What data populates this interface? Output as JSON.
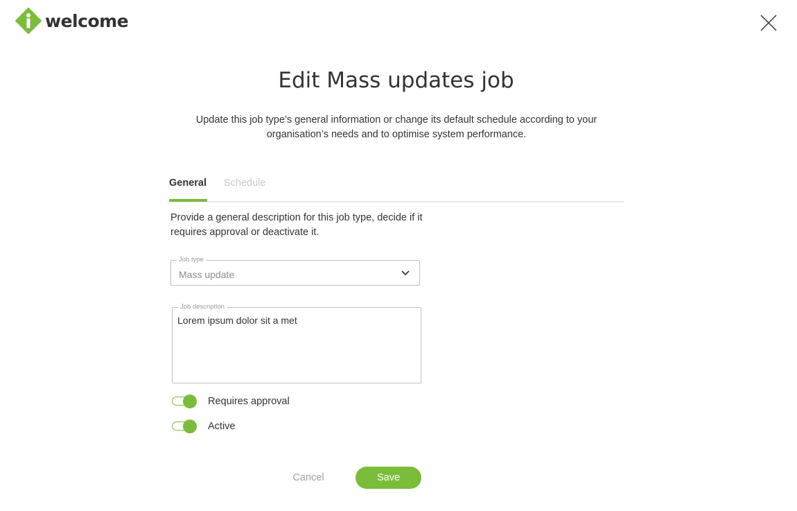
{
  "brand": {
    "logo_text": "welcome",
    "logo_icon": "i-diamond-logo-icon",
    "accent_color": "#7bbd3a"
  },
  "header": {
    "close_icon": "close-icon"
  },
  "dialog": {
    "title": "Edit Mass updates job",
    "subtitle": "Update this job type’s general information or change its default schedule according to your organisation’s needs and to optimise system performance."
  },
  "tabs": [
    {
      "label": "General",
      "active": true
    },
    {
      "label": "Schedule",
      "active": false
    }
  ],
  "general": {
    "description": "Provide a general description for this job type, decide if it requires approval or deactivate it.",
    "job_type": {
      "label": "Job type",
      "value": "Mass update"
    },
    "job_description": {
      "label": "Job description",
      "value": "Lorem ipsum dolor sit a met"
    },
    "toggles": [
      {
        "label": "Requires approval",
        "on": true
      },
      {
        "label": "Active",
        "on": true
      }
    ]
  },
  "actions": {
    "cancel_label": "Cancel",
    "save_label": "Save"
  }
}
